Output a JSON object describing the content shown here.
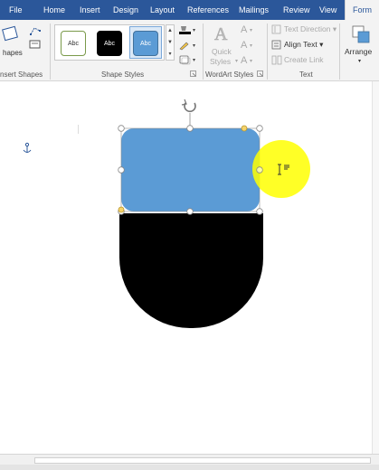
{
  "tabs": {
    "file": "File",
    "home": "Home",
    "insert": "Insert",
    "design": "Design",
    "layout": "Layout",
    "references": "References",
    "mailings": "Mailings",
    "review": "Review",
    "view": "View",
    "format": "Form"
  },
  "ribbon": {
    "insert_shapes": {
      "shapes_label": "hapes",
      "group_label": "nsert Shapes"
    },
    "shape_styles": {
      "group_label": "Shape Styles",
      "styles": [
        "Abc",
        "Abc",
        "Abc"
      ]
    },
    "wordart_styles": {
      "quick_styles_line1": "Quick",
      "quick_styles_line2": "Styles",
      "group_label": "WordArt Styles",
      "text_glyph": "A"
    },
    "text": {
      "text_direction": "Text Direction",
      "align_text": "Align Text",
      "create_link": "Create Link",
      "group_label": "Text"
    },
    "arrange": {
      "label": "Arrange"
    }
  },
  "colors": {
    "tab_bar": "#2b579a",
    "shape_top_fill": "#5b9bd5",
    "shape_bottom_fill": "#000000",
    "highlight": "#ffff00"
  },
  "icons": {
    "anchor": "anchor-icon",
    "rotate": "rotate-handle-icon",
    "cursor": "text-cursor-icon"
  }
}
